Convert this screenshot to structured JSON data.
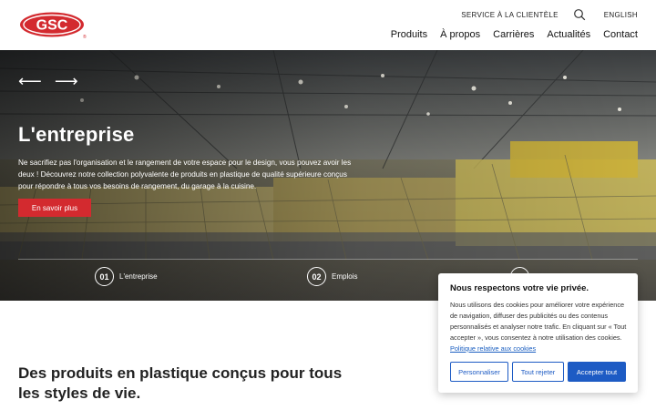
{
  "logo": {
    "text": "GSC",
    "registered": "®",
    "color": "#d32a2f"
  },
  "topbar": {
    "service": "SERVICE À LA CLIENTÈLE",
    "search_icon": "search-icon",
    "language": "ENGLISH"
  },
  "nav": {
    "items": [
      "Produits",
      "À propos",
      "Carrières",
      "Actualités",
      "Contact"
    ]
  },
  "hero": {
    "prev_icon": "arrow-left-icon",
    "next_icon": "arrow-right-icon",
    "prev_glyph": "⟵",
    "next_glyph": "⟶",
    "title": "L'entreprise",
    "text": "Ne sacrifiez pas l'organisation et le rangement de votre espace pour le design, vous pouvez avoir les deux ! Découvrez notre collection polyvalente de produits en plastique de qualité supérieure conçus pour répondre à tous vos besoins de rangement, du garage à la cuisine.",
    "button": "En savoir plus",
    "steps": [
      {
        "num": "01",
        "label": "L'entreprise"
      },
      {
        "num": "02",
        "label": "Emplois"
      },
      {
        "num": "03",
        "label": ""
      }
    ]
  },
  "section": {
    "title": "Des produits en plastique conçus pour tous les styles de vie."
  },
  "cookie": {
    "title": "Nous respectons votre vie privée.",
    "text": "Nous utilisons des cookies pour améliorer votre expérience de navigation, diffuser des publicités ou des contenus personnalisés et analyser notre trafic. En cliquant sur « Tout accepter », vous consentez à notre utilisation des cookies.",
    "link": "Politique relative aux cookies",
    "customize": "Personnaliser",
    "reject": "Tout rejeter",
    "accept": "Accepter tout",
    "accent": "#1d5bc4"
  },
  "colors": {
    "brand_red": "#d32a2f",
    "button_blue": "#1d5bc4"
  }
}
